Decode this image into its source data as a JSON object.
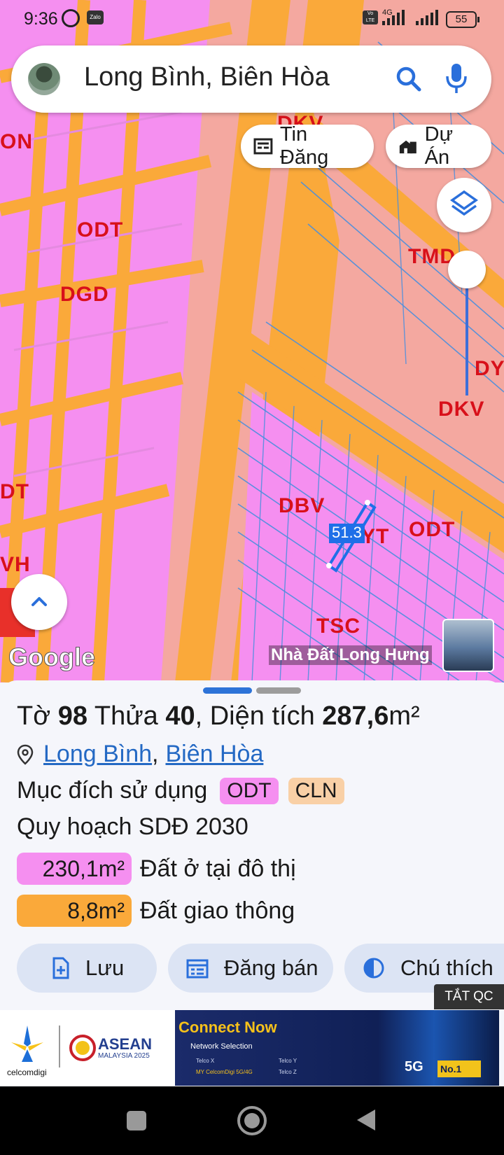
{
  "status_bar": {
    "time": "9:36",
    "zalo": "Zalo",
    "volte": "Vo LTE",
    "network": "4G",
    "battery": "55"
  },
  "search": {
    "query": "Long Bình, Biên Hòa"
  },
  "chips": [
    {
      "label": "Tin Đăng",
      "icon": "newspaper-icon"
    },
    {
      "label": "Dự Án",
      "icon": "building-icon"
    }
  ],
  "map": {
    "labels": [
      "ON",
      "DKV",
      "ODT",
      "DGD",
      "TMD",
      "DY",
      "DKV",
      "DT",
      "DBV",
      "YT",
      "ODT",
      "VH",
      "TSC"
    ],
    "measurement": "51.3",
    "credit": "Nhà Đất Long Hưng",
    "google": "Google"
  },
  "parcel": {
    "to_label": "Tờ",
    "to_value": "98",
    "thua_label": "Thửa",
    "thua_value": "40",
    "area_label": ", Diện tích",
    "area_value": "287,6",
    "area_unit": "m²",
    "ward": "Long Bình",
    "city": "Biên Hòa",
    "separator": ",",
    "purpose_label": "Mục đích sử dụng",
    "purposes": [
      {
        "code": "ODT",
        "color": "#f58ff0"
      },
      {
        "code": "CLN",
        "color": "#f9d0a6"
      }
    ],
    "plan_label": "Quy hoạch SDĐ 2030",
    "areas": [
      {
        "value": "230,1m²",
        "label": "Đất ở tại đô thị",
        "color": "#f58ff0"
      },
      {
        "value": "8,8m²",
        "label": "Đất giao thông",
        "color": "#faa93a"
      }
    ]
  },
  "actions": {
    "save": "Lưu",
    "post": "Đăng bán",
    "legend": "Chú thích"
  },
  "ad": {
    "close_label": "TẮT QC",
    "brand": "celcomdigi",
    "asean": "ASEAN",
    "asean_sub": "MALAYSIA 2025",
    "headline": "Connect Now",
    "network_selection": "Network Selection",
    "operators": [
      "Telco X",
      "Telco Y",
      "MY CelcomDigi 5G/4G",
      "Telco Z"
    ],
    "badge_5g": "5G",
    "badge_no1": "No.1"
  }
}
